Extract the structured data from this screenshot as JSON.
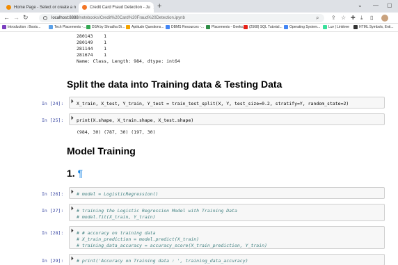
{
  "browser": {
    "tabs": [
      {
        "title": "Home Page - Select or create a n",
        "color": "#f28b00"
      },
      {
        "title": "Credit Card Fraud Detection - Ju",
        "color": "#f37626"
      }
    ],
    "new_tab": "+",
    "url_host": "localhost:8888",
    "url_path": "/notebooks/Credit%20Card%20Fraud%20Detection.ipynb",
    "bookmarks": [
      {
        "label": "Introduction : Boots...",
        "color": "#7b3fbf"
      },
      {
        "label": "Tech Placements -...",
        "color": "#5aa0e8"
      },
      {
        "label": "DSA by Shradha Di...",
        "color": "#34a853"
      },
      {
        "label": "Aptitude Questions...",
        "color": "#f4a400"
      },
      {
        "label": "DBMS Resources -...",
        "color": "#4285f4"
      },
      {
        "label": "Placements - Geeks...",
        "color": "#2f8d46"
      },
      {
        "label": "(2568) SQL Tutorial...",
        "color": "#e62117"
      },
      {
        "label": "Operating System...",
        "color": "#4285f4"
      },
      {
        "label": "Luv | Linktree",
        "color": "#39e09b"
      },
      {
        "label": "HTML Symbols, Enti...",
        "color": "#333333"
      }
    ]
  },
  "notebook": {
    "series_output": [
      "280143    1",
      "280149    1",
      "281144    1",
      "281674    1",
      "Name: Class, Length: 984, dtype: int64"
    ],
    "heading_split": "Split the data into Training data & Testing Data",
    "cell24": {
      "prompt": "In [24]:",
      "code": "X_train, X_test, Y_train, Y_test = train_test_split(X, Y, test_size=0.2, stratify=Y, random_state=2)"
    },
    "cell25": {
      "prompt": "In [25]:",
      "code": "print(X.shape, X_train.shape, X_test.shape)",
      "output": "(984, 30) (787, 30) (197, 30)"
    },
    "heading_model": "Model Training",
    "heading_one": "1.",
    "pilcrow": "¶",
    "cell26": {
      "prompt": "In [26]:",
      "code": "# model = LogisticRegression()"
    },
    "cell27": {
      "prompt": "In [27]:",
      "line1": "# training the Logistic Regression Model with Training Data",
      "line2": "# model.fit(X_train, Y_train)"
    },
    "cell28": {
      "prompt": "In [28]:",
      "line1": "# # accuracy on training data",
      "line2": "# X_train_prediction = model.predict(X_train)",
      "line3": "# training_data_accuracy = accuracy_score(X_train_prediction, Y_train)"
    },
    "cell29": {
      "prompt": "In [29]:",
      "code": "# print('Accuracy on Training data : ', training_data_accuracy)"
    },
    "run_icon": "⏵"
  }
}
